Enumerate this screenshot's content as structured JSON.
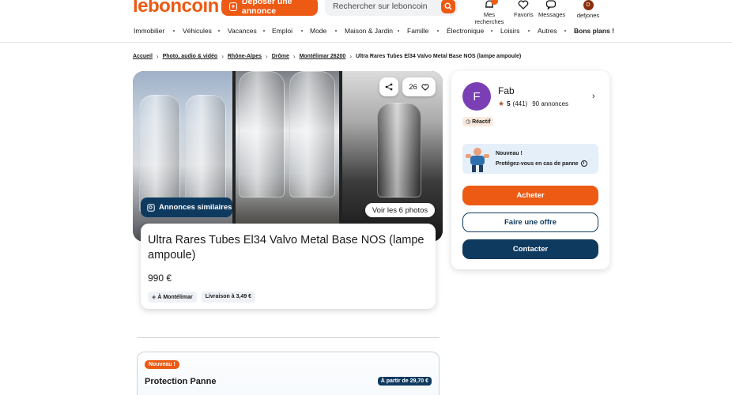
{
  "header": {
    "logo": "leboncoin",
    "post_label": "Déposer une annonce",
    "search_placeholder": "Rechercher sur leboncoin",
    "icons": [
      {
        "label": "Mes recherches",
        "icon": "bell-icon"
      },
      {
        "label": "Favoris",
        "icon": "heart-icon"
      },
      {
        "label": "Messages",
        "icon": "chat-icon"
      },
      {
        "label": "defjones",
        "icon": "avatar"
      }
    ],
    "user_initial": "D"
  },
  "categories": [
    "Immobilier",
    "Véhicules",
    "Vacances",
    "Emploi",
    "Mode",
    "Maison & Jardin",
    "Famille",
    "Électronique",
    "Loisirs",
    "Autres",
    "Bons plans !"
  ],
  "breadcrumb": {
    "items": [
      "Accueil",
      "Photo, audio & vidéo",
      "Rhône-Alpes",
      "Drôme",
      "Montélimar 26200"
    ],
    "current": "Ultra Rares Tubes El34 Valvo Metal Base NOS (lampe ampoule)"
  },
  "gallery": {
    "likes": "26",
    "similar_label": "Annonces similaires",
    "all_photos_label": "Voir les 6 photos"
  },
  "listing": {
    "title": "Ultra Rares Tubes El34 Valvo Metal Base NOS (lampe ampoule)",
    "price": "990 €",
    "location_tag": "À Montélimar",
    "delivery_tag": "Livraison à 3,49 €"
  },
  "protection": {
    "new_badge": "Nouveau !",
    "title": "Protection Panne",
    "price_badge": "À partir de 29,70 €"
  },
  "seller": {
    "initial": "F",
    "name": "Fab",
    "rating": "5",
    "reviews": "(441)",
    "ads": "90 annonces",
    "reactive": "Réactif",
    "promo_title": "Nouveau !",
    "promo_text": "Protégez-vous en cas de panne",
    "buy_label": "Acheter",
    "offer_label": "Faire une offre",
    "contact_label": "Contacter"
  },
  "colors": {
    "brand": "#ec5a13",
    "navy": "#0f3a5f"
  }
}
